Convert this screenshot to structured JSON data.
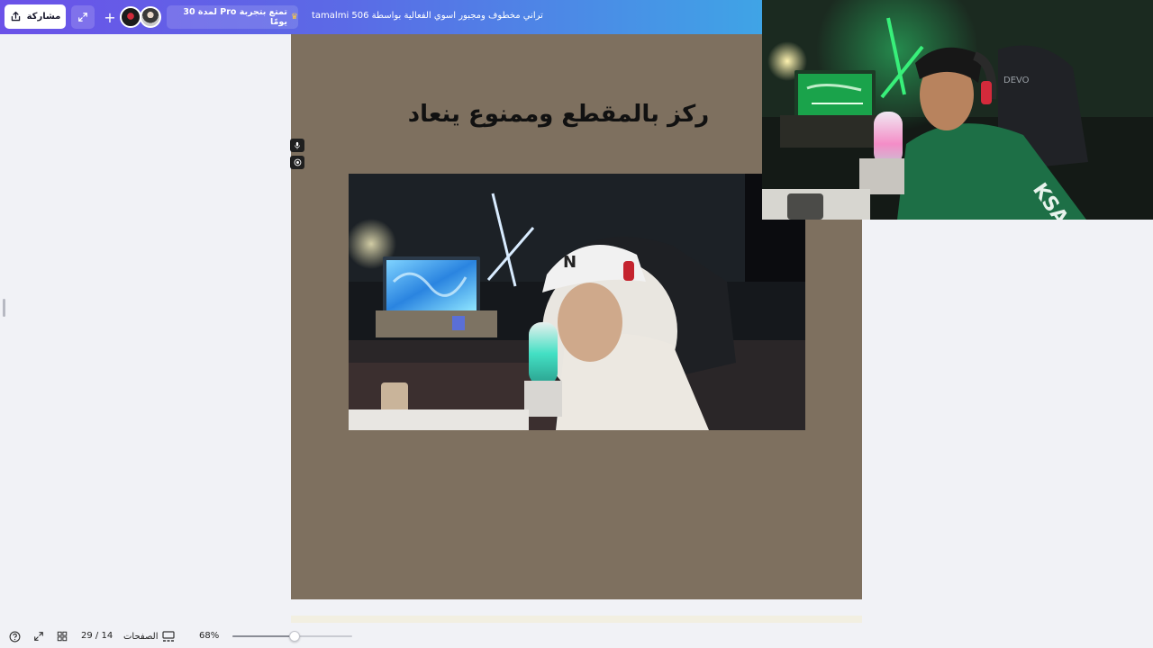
{
  "header": {
    "share_label": "مشاركة",
    "pro_offer": "تمتع بتجربة Pro لمدة 30 يومًا",
    "doc_title": "تراني مخطوف ومجبور اسوي الفعالية بواسطة tamalmi 506",
    "icons": [
      "share-icon",
      "expand-icon",
      "plus-icon",
      "crown-icon"
    ]
  },
  "page": {
    "heading": "ركز بالمقطع وممنوع ينعاد",
    "background": "#7e705f"
  },
  "webcam": {
    "brand_text": "DEVO",
    "shirt_text": "KSA"
  },
  "footer": {
    "page_counter": "29 / 14",
    "pages_label": "الصفحات",
    "zoom_label": "68%",
    "zoom_fraction": 0.52
  },
  "colors": {
    "header_gradient_start": "#6b52e8",
    "header_gradient_end": "#3fa4e6",
    "accent_green": "#38f07a"
  }
}
